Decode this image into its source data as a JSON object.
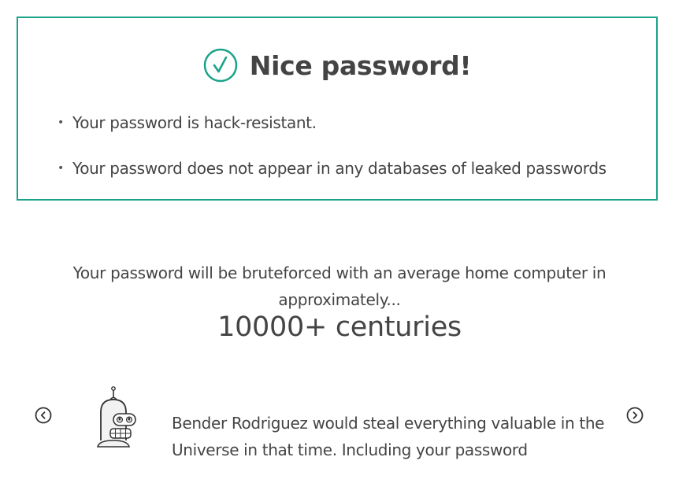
{
  "result": {
    "icon": "check-circle-icon",
    "accent_color": "#1aa38a",
    "title": "Nice password!",
    "bullets": [
      "Your password is hack-resistant.",
      "Your password does not appear in any databases of leaked passwords"
    ]
  },
  "estimate": {
    "intro": "Your password will be bruteforced with an average home computer in approximately...",
    "value": "10000+ centuries"
  },
  "comparison": {
    "prev_icon": "chevron-left-circle-icon",
    "next_icon": "chevron-right-circle-icon",
    "image_icon": "bender-robot-icon",
    "text": "Bender Rodriguez would steal everything valuable in the Universe in that time. Including your password"
  }
}
